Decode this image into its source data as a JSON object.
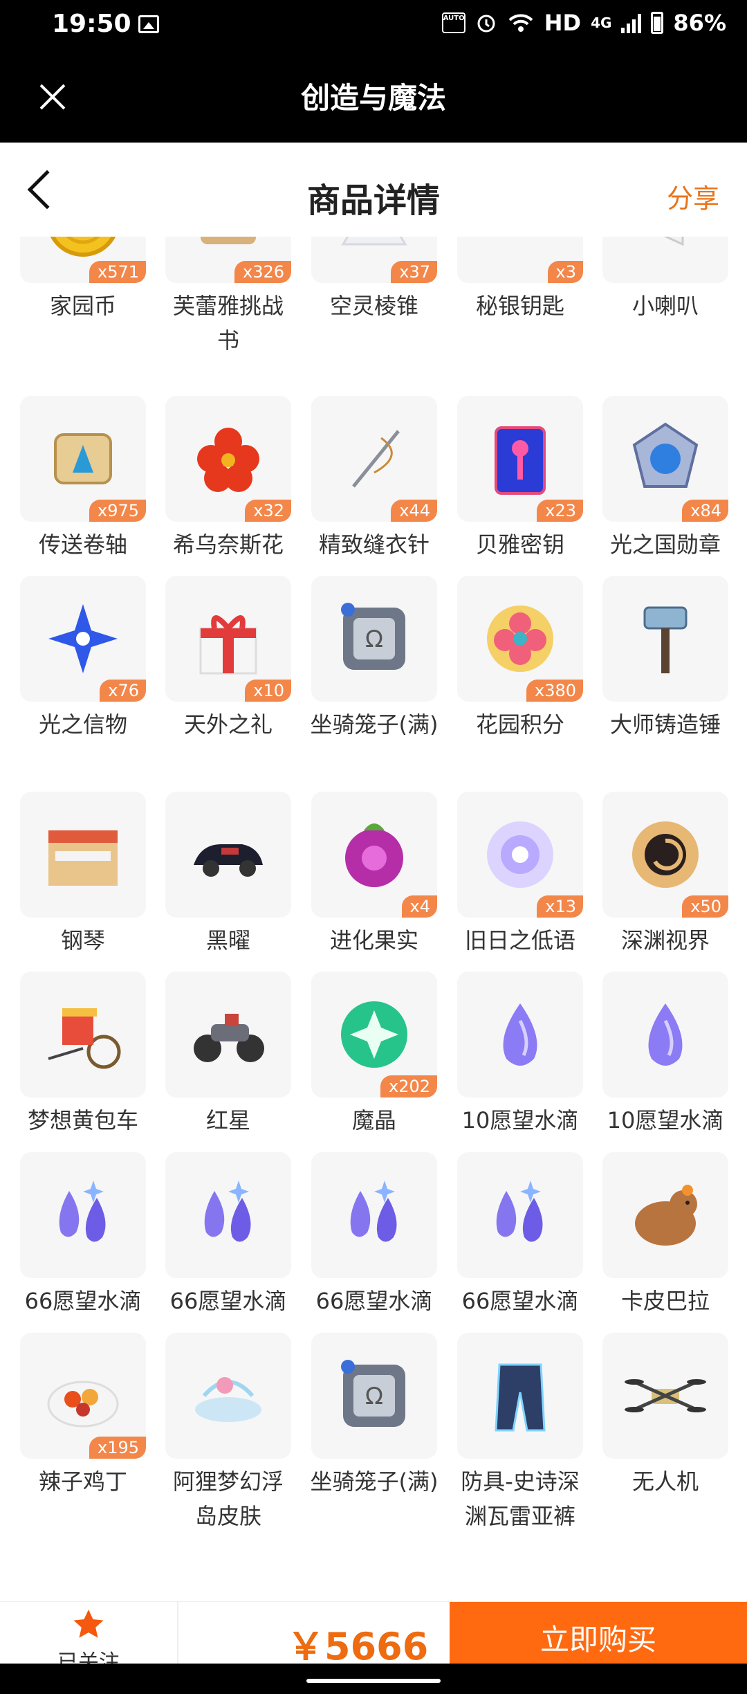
{
  "status_bar": {
    "time": "19:50",
    "network": "HD",
    "network_type": "4G",
    "battery": "86%",
    "icons": [
      "gallery-icon",
      "auto-icon",
      "alarm-icon",
      "wifi-icon",
      "signal-icon",
      "battery-icon"
    ]
  },
  "app_bar": {
    "title": "创造与魔法"
  },
  "header": {
    "title": "商品详情",
    "share": "分享"
  },
  "items": [
    {
      "label": "家园币",
      "qty": "x571",
      "icon": "gold-coin-icon"
    },
    {
      "label": "芙蕾雅挑战书",
      "qty": "x326",
      "icon": "challenge-scroll-icon"
    },
    {
      "label": "空灵棱锥",
      "qty": "x37",
      "icon": "pyramid-icon"
    },
    {
      "label": "秘银钥匙",
      "qty": "x3",
      "icon": "key-icon"
    },
    {
      "label": "小喇叭",
      "qty": "",
      "icon": "megaphone-icon"
    },
    {
      "label": "传送卷轴",
      "qty": "x975",
      "icon": "scroll-icon"
    },
    {
      "label": "希乌奈斯花",
      "qty": "x32",
      "icon": "red-flower-icon"
    },
    {
      "label": "精致缝衣针",
      "qty": "x44",
      "icon": "needle-icon"
    },
    {
      "label": "贝雅密钥",
      "qty": "x23",
      "icon": "card-key-icon"
    },
    {
      "label": "光之国勋章",
      "qty": "x84",
      "icon": "medal-icon"
    },
    {
      "label": "光之信物",
      "qty": "x76",
      "icon": "blue-star-icon"
    },
    {
      "label": "天外之礼",
      "qty": "x10",
      "icon": "gift-box-icon"
    },
    {
      "label": "坐骑笼子(满)",
      "qty": "",
      "icon": "mount-cage-icon"
    },
    {
      "label": "花园积分",
      "qty": "x380",
      "icon": "flower-token-icon"
    },
    {
      "label": "大师铸造锤",
      "qty": "",
      "icon": "hammer-icon"
    },
    {
      "label": "钢琴",
      "qty": "",
      "icon": "piano-icon"
    },
    {
      "label": "黑曜",
      "qty": "",
      "icon": "car-icon"
    },
    {
      "label": "进化果实",
      "qty": "x4",
      "icon": "berry-icon"
    },
    {
      "label": "旧日之低语",
      "qty": "x13",
      "icon": "orb-icon"
    },
    {
      "label": "深渊视界",
      "qty": "x50",
      "icon": "vortex-icon"
    },
    {
      "label": "梦想黄包车",
      "qty": "",
      "icon": "rickshaw-icon"
    },
    {
      "label": "红星",
      "qty": "",
      "icon": "motorcycle-icon"
    },
    {
      "label": "魔晶",
      "qty": "x202",
      "icon": "green-crystal-icon"
    },
    {
      "label": "10愿望水滴",
      "qty": "",
      "icon": "water-drop-icon"
    },
    {
      "label": "10愿望水滴",
      "qty": "",
      "icon": "water-drop-icon"
    },
    {
      "label": "66愿望水滴",
      "qty": "",
      "icon": "water-drops-icon"
    },
    {
      "label": "66愿望水滴",
      "qty": "",
      "icon": "water-drops-icon"
    },
    {
      "label": "66愿望水滴",
      "qty": "",
      "icon": "water-drops-icon"
    },
    {
      "label": "66愿望水滴",
      "qty": "",
      "icon": "water-drops-icon"
    },
    {
      "label": "卡皮巴拉",
      "qty": "",
      "icon": "capybara-icon"
    },
    {
      "label": "辣子鸡丁",
      "qty": "x195",
      "icon": "food-plate-icon"
    },
    {
      "label": "阿狸梦幻浮岛皮肤",
      "qty": "",
      "icon": "floating-island-icon"
    },
    {
      "label": "坐骑笼子(满)",
      "qty": "",
      "icon": "mount-cage-icon"
    },
    {
      "label": "防具-史诗深渊瓦雷亚裤",
      "qty": "",
      "icon": "armor-pants-icon"
    },
    {
      "label": "无人机",
      "qty": "",
      "icon": "drone-icon"
    }
  ],
  "bottom_bar": {
    "follow_label": "已关注",
    "price": "￥5666",
    "buy_label": "立即购买"
  },
  "colors": {
    "accent": "#ff6a11",
    "price": "#ee6b10",
    "qty_badge": "#f3874a",
    "share": "#e8741a"
  }
}
